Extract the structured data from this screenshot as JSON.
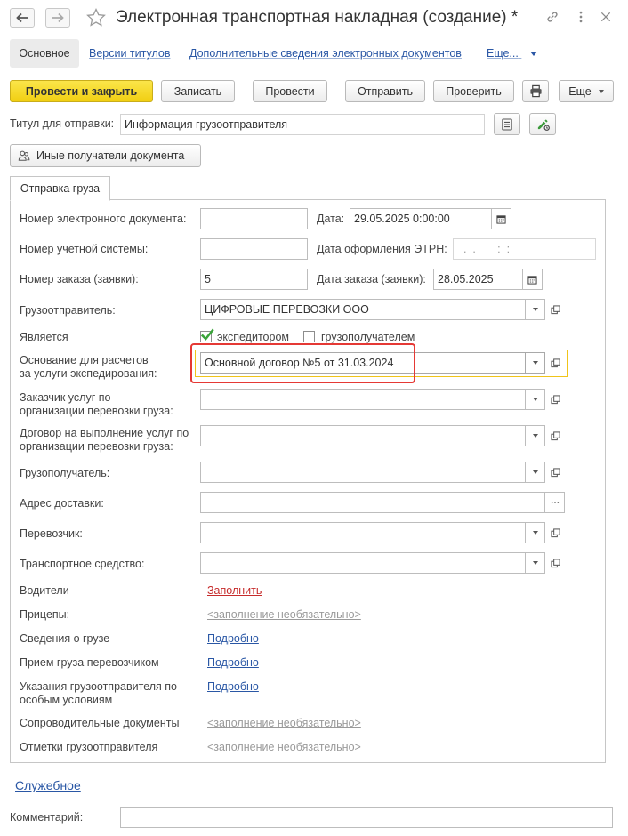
{
  "window": {
    "title": "Электронная транспортная накладная (создание) *"
  },
  "nav": {
    "active": "Основное",
    "links": [
      "Версии титулов",
      "Дополнительные сведения электронных документов",
      "Еще..."
    ]
  },
  "toolbar": {
    "post_close": "Провести и закрыть",
    "save": "Записать",
    "post": "Провести",
    "send": "Отправить",
    "check": "Проверить",
    "more": "Еще"
  },
  "header": {
    "title_label": "Титул для отправки:",
    "title_value": "Информация грузоотправителя",
    "other_recipients": "Иные получатели документа"
  },
  "tab": {
    "label": "Отправка груза"
  },
  "form": {
    "doc_number_label": "Номер электронного документа:",
    "doc_number_value": "",
    "date_label": "Дата:",
    "date_value": "29.05.2025  0:00:00",
    "account_number_label": "Номер учетной системы:",
    "account_number_value": "",
    "etrn_date_label": "Дата оформления ЭТРН:",
    "etrn_date_value": "  .  .       :  :",
    "order_number_label": "Номер заказа (заявки):",
    "order_number_value": "5",
    "order_date_label": "Дата заказа (заявки):",
    "order_date_value": "28.05.2025",
    "shipper_label": "Грузоотправитель:",
    "shipper_value": "ЦИФРОВЫЕ ПЕРЕВОЗКИ ООО",
    "is_label": "Является",
    "forwarder_label": "экспедитором",
    "consignee_check_label": "грузополучателем",
    "basis_label_1": "Основание для расчетов",
    "basis_label_2": "за услуги экспедирования:",
    "basis_value": "Основной договор №5 от 31.03.2024",
    "customer_label_1": "Заказчик услуг по",
    "customer_label_2": "организации перевозки груза:",
    "customer_value": "",
    "contract_label_1": "Договор на выполнение услуг по",
    "contract_label_2": "организации перевозки груза:",
    "contract_value": "",
    "consignee_label": "Грузополучатель:",
    "consignee_value": "",
    "address_label": "Адрес доставки:",
    "address_value": "",
    "carrier_label": "Перевозчик:",
    "carrier_value": "",
    "vehicle_label": "Транспортное средство:",
    "vehicle_value": "",
    "drivers_label": "Водители",
    "drivers_link": "Заполнить",
    "trailers_label": "Прицепы:",
    "trailers_link": "<заполнение необязательно>",
    "cargo_label": "Сведения о грузе",
    "cargo_link": "Подробно",
    "reception_label": "Прием груза перевозчиком",
    "reception_link": "Подробно",
    "instructions_label_1": "Указания грузоотправителя по",
    "instructions_label_2": "особым условиям",
    "instructions_link": "Подробно",
    "accompanying_label": "Сопроводительные документы",
    "accompanying_link": "<заполнение необязательно>",
    "marks_label": "Отметки грузоотправителя",
    "marks_link": "<заполнение необязательно>"
  },
  "footer": {
    "service_link": "Служебное",
    "comment_label": "Комментарий:",
    "comment_value": ""
  },
  "colors": {
    "primary_button": "#f1cf12",
    "link": "#2a57a5",
    "required_link": "#c62b2b",
    "focus_border": "#f0c419",
    "annotation_red": "#e53935"
  }
}
